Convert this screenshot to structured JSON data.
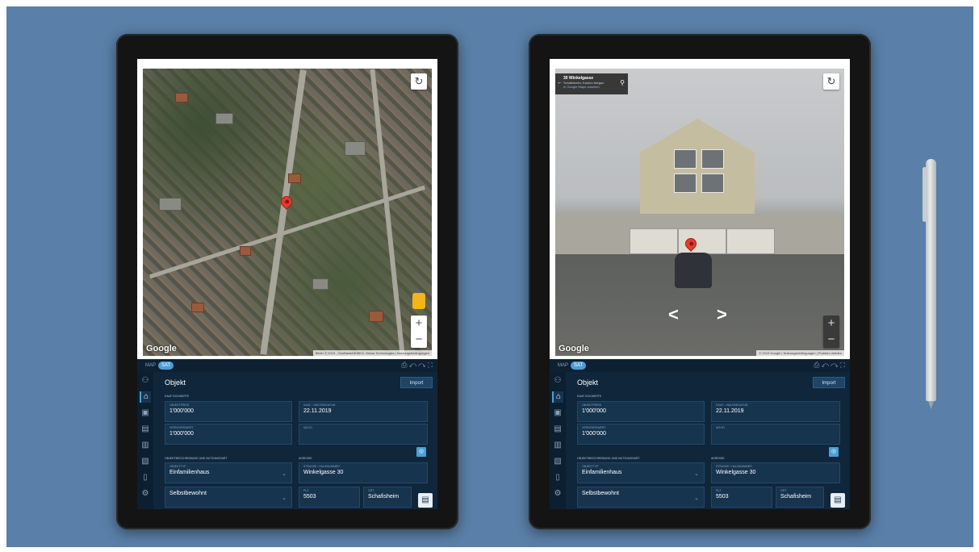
{
  "map_view": {
    "google": "Google",
    "attribution": "Bilder © 2019 , GeoBasisDE/BKG, Maxar Technologies | Nutzungsbedingungen",
    "refresh_icon": "refresh-icon",
    "zoom_in": "+",
    "zoom_out": "−"
  },
  "street_view": {
    "address": "30 Winkelgasse",
    "locality": "Schafisheim, Kanton Aargau",
    "open_link": "In Google Maps ansehen",
    "google": "Google",
    "attribution": "© 2019 Google | Nutzungsbedingungen | Problem melden",
    "zoom_in": "+",
    "zoom_out": "−",
    "nav_left": "<",
    "nav_right": ">"
  },
  "app": {
    "tabs": {
      "map": "MAP",
      "sat": "SAT"
    },
    "tool_icons": [
      "print-icon",
      "undo-icon",
      "redo-icon",
      "fullscreen-icon"
    ],
    "sidebar_icons": [
      "person-icon",
      "home-icon",
      "object-icon",
      "money-icon",
      "chart-icon",
      "document-icon",
      "file-icon",
      "settings-document-icon"
    ],
    "title": "Objekt",
    "import_label": "Import",
    "sections": {
      "kaufeckwerte": "KAUF-ECKWERTE",
      "objektbeschreibung": "OBJEKTBESCHREIBUNG UND NUTZUNGSART",
      "adresse": "ADRESSE"
    },
    "fields": {
      "objektpreis": {
        "label": "OBJEKTPREIS",
        "value": "1'000'000"
      },
      "kaufdatum": {
        "label": "KAUF- / ABLÖSEDATUM",
        "value": "22.11.2019"
      },
      "verkehrswert": {
        "label": "VERKEHRSWERT",
        "value": "1'000'000"
      },
      "iazi_id": {
        "label": "IAZI ID",
        "value": ""
      },
      "objekttyp": {
        "label": "OBJEKTTYP",
        "value": "Einfamilienhaus"
      },
      "strasse": {
        "label": "STRASSE / HAUSNUMMER",
        "value": "Winkelgasse 30"
      },
      "nutzungsart": {
        "label": "",
        "value": "Selbstbewohnt"
      },
      "plz": {
        "label": "PLZ",
        "value": "5503"
      },
      "ort": {
        "label": "ORT",
        "value": "Schafisheim"
      }
    }
  },
  "colors": {
    "background": "#5a7fa8",
    "app_bg": "#10263a",
    "accent": "#4b9fd6"
  }
}
